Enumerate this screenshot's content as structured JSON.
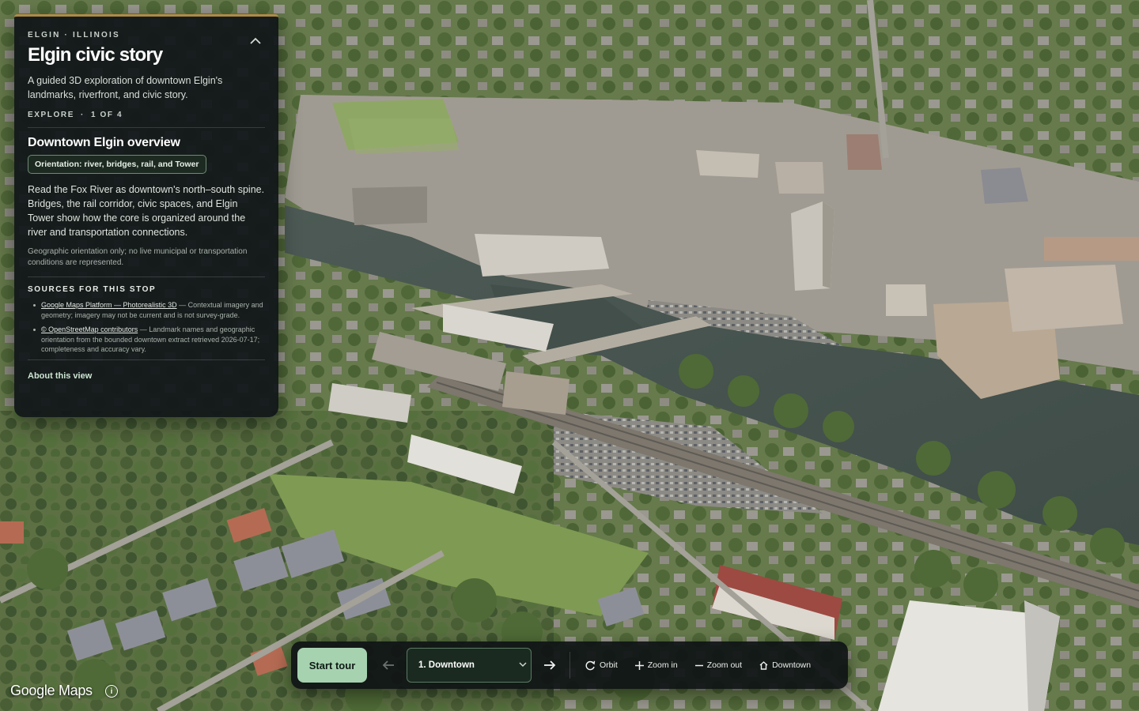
{
  "panel": {
    "eyebrow": "ELGIN · ILLINOIS",
    "title": "Elgin civic story",
    "lede": "A guided 3D exploration of downtown Elgin's landmarks, riverfront, and civic story.",
    "progress_label": "EXPLORE",
    "progress_sep": "·",
    "progress_count": "1 OF 4",
    "stop_title": "Downtown Elgin overview",
    "stop_tag": "Orientation: river, bridges, rail, and Tower",
    "stop_body": "Read the Fox River as downtown's north–south spine. Bridges, the rail corridor, civic spaces, and Elgin Tower show how the core is organized around the river and transportation connections.",
    "stop_note": "Geographic orientation only; no live municipal or transportation conditions are represented.",
    "sources_heading": "SOURCES FOR THIS STOP",
    "sources": [
      {
        "link": "Google Maps Platform — Photorealistic 3D",
        "text": " — Contextual imagery and geometry; imagery may not be current and is not survey-grade."
      },
      {
        "link": "© OpenStreetMap contributors",
        "text": " — Landmark names and geographic orientation from the bounded downtown extract retrieved 2026-07-17; completeness and accuracy vary."
      }
    ],
    "about_link": "About this view",
    "collapse_icon": "chevron-up-icon"
  },
  "toolbar": {
    "start_tour": "Start tour",
    "prev_icon": "arrow-left-icon",
    "next_icon": "arrow-right-icon",
    "stop_select_value": "1. Downtown",
    "orbit": "Orbit",
    "zoom_in": "Zoom in",
    "zoom_out": "Zoom out",
    "downtown": "Downtown"
  },
  "attribution": {
    "logo": "Google Maps",
    "info_icon": "i"
  },
  "colors": {
    "panel_bg": "#111618",
    "panel_accent": "#b08a46",
    "primary_button": "#a6d2b0",
    "select_border": "#5a7a62"
  }
}
